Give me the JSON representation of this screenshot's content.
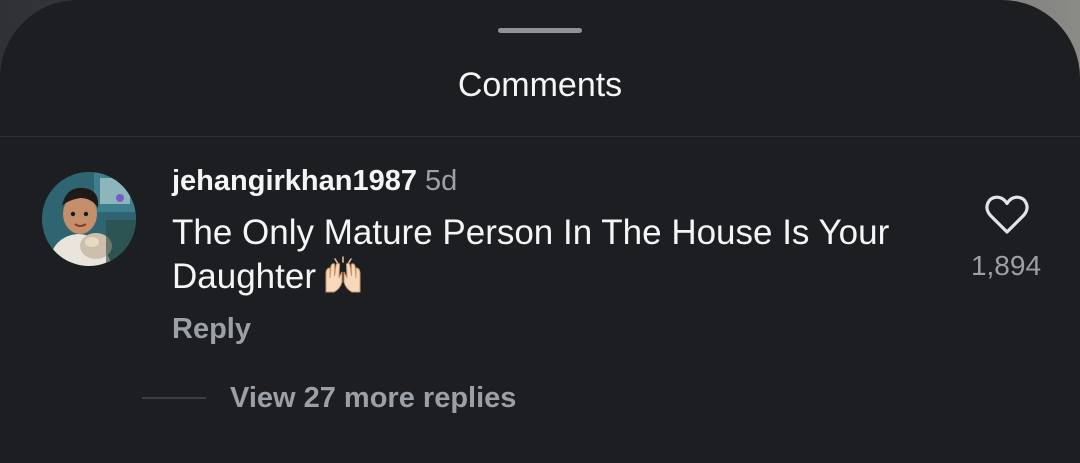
{
  "sheet": {
    "title": "Comments"
  },
  "comment": {
    "username": "jehangirkhan1987",
    "age": "5d",
    "text": "The Only Mature Person In The House Is Your Daughter",
    "emoji": "raising-hands",
    "reply_label": "Reply",
    "like_count": "1,894",
    "view_replies_label": "View 27 more replies"
  },
  "colors": {
    "sheet_bg": "#1c1e21",
    "primary_text": "#f4f5f6",
    "secondary_text": "#9aa0a6"
  }
}
